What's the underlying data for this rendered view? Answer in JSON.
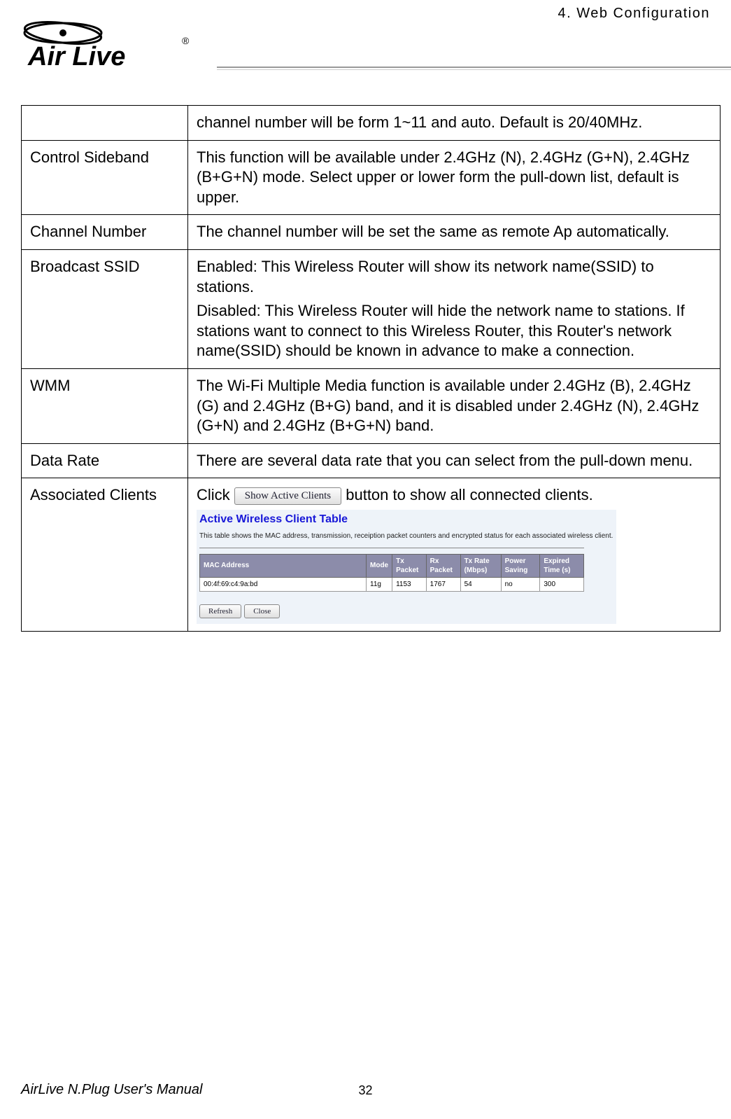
{
  "header": {
    "breadcrumb": "4.  Web  Configuration"
  },
  "logo": {
    "top_text": "Air Live",
    "registered": "®"
  },
  "table": {
    "rows": [
      {
        "label": "",
        "desc": [
          "channel number will be form 1~11 and auto. Default is 20/40MHz."
        ]
      },
      {
        "label": "Control Sideband",
        "desc": [
          "This function will be available under 2.4GHz (N), 2.4GHz (G+N), 2.4GHz (B+G+N) mode. Select upper or lower form the pull-down list, default is upper."
        ]
      },
      {
        "label": "Channel Number",
        "desc": [
          "The channel number will be set the same as remote Ap automatically."
        ]
      },
      {
        "label": "Broadcast SSID",
        "desc": [
          "Enabled: This Wireless Router will show its network name(SSID) to stations.",
          "Disabled: This Wireless Router will hide the network name to stations. If stations want to connect to this Wireless Router, this Router's network name(SSID) should be known in advance to make a connection."
        ]
      },
      {
        "label": "WMM",
        "desc": [
          "The Wi-Fi Multiple Media function is available under 2.4GHz (B), 2.4GHz (G) and 2.4GHz (B+G) band, and it is disabled under 2.4GHz (N), 2.4GHz (G+N) and 2.4GHz (B+G+N) band."
        ]
      },
      {
        "label": "Data Rate",
        "desc": [
          "There are several data rate that you can select from the pull-down menu."
        ]
      },
      {
        "label": "Associated Clients",
        "click_prefix": "Click ",
        "button_label": "Show Active Clients",
        "click_suffix": "  button to show all connected clients."
      }
    ]
  },
  "embedded": {
    "title": "Active Wireless Client Table",
    "description": "This table shows the MAC address, transmission, receiption packet counters and encrypted status for each associated wireless client.",
    "headers": [
      "MAC Address",
      "Mode",
      "Tx Packet",
      "Rx Packet",
      "Tx Rate (Mbps)",
      "Power Saving",
      "Expired Time (s)"
    ],
    "row": [
      "00:4f:69:c4:9a:bd",
      "11g",
      "1153",
      "1767",
      "54",
      "no",
      "300"
    ],
    "buttons": {
      "refresh": "Refresh",
      "close": "Close"
    }
  },
  "footer": {
    "left": "AirLive N.Plug User's Manual",
    "page": "32"
  }
}
